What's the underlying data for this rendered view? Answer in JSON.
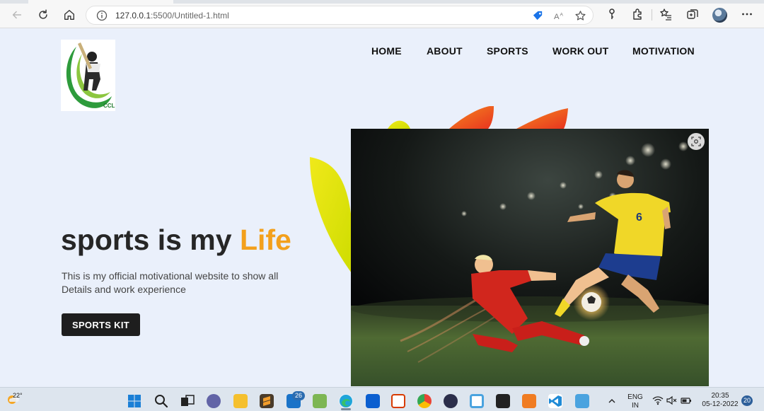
{
  "browser": {
    "url_host": "127.0.0.1",
    "url_rest": ":5500/Untitled-1.html",
    "icons": [
      "back-arrow-icon",
      "refresh-icon",
      "home-icon",
      "info-icon",
      "tag-icon",
      "read-aloud-icon",
      "favorite-star-icon",
      "key-icon",
      "extensions-icon",
      "favorites-icon",
      "collections-icon",
      "profile-avatar",
      "more-icon"
    ]
  },
  "site": {
    "logo_text": "CCL",
    "nav": {
      "home": "HOME",
      "about": "ABOUT",
      "sports": "SPORTS",
      "workout": "WORK OUT",
      "motivation": "MOTIVATION"
    },
    "hero": {
      "title_main": "sports is my ",
      "title_accent": "Life",
      "desc_line1": "This is my official motivational website to show all",
      "desc_line2": "Details and work experience",
      "button": "SPORTS KIT"
    },
    "photo_player_number": "6",
    "colors": {
      "accent": "#f3a01c",
      "background": "#eaf0fb",
      "button": "#1e1e1e",
      "logo_green": "#2e9b3c"
    }
  },
  "taskbar": {
    "weather_temp": "22°",
    "mail_badge": "26",
    "lang_top": "ENG",
    "lang_bottom": "IN",
    "time": "20:35",
    "date": "05-12-2022",
    "notif_count": "20"
  }
}
